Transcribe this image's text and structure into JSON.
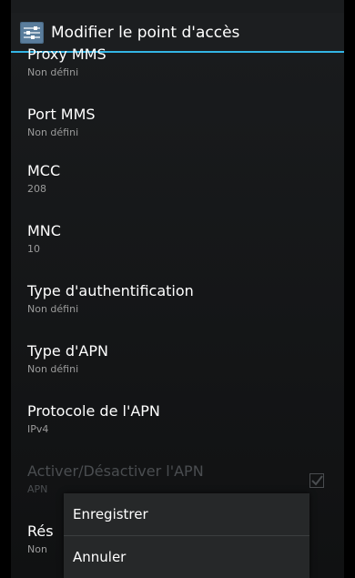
{
  "action_bar": {
    "title": "Modifier le point d'accès",
    "icon": "settings-sliders-icon"
  },
  "preferences": [
    {
      "title": "Proxy MMS",
      "summary": "Non défini"
    },
    {
      "title": "Port MMS",
      "summary": "Non défini"
    },
    {
      "title": "MCC",
      "summary": "208"
    },
    {
      "title": "MNC",
      "summary": "10"
    },
    {
      "title": "Type d'authentification",
      "summary": "Non défini"
    },
    {
      "title": "Type d'APN",
      "summary": "Non défini"
    },
    {
      "title": "Protocole de l'APN",
      "summary": "IPv4"
    },
    {
      "title": "Activer/Désactiver l'APN",
      "summary": "APN",
      "checked": true,
      "enabled": false
    },
    {
      "title": "Rés",
      "summary": "Non"
    }
  ],
  "menu": {
    "items": [
      "Enregistrer",
      "Annuler"
    ]
  },
  "colors": {
    "accent": "#33b5e5",
    "background": "#141516",
    "summary": "#9b9b9b"
  }
}
